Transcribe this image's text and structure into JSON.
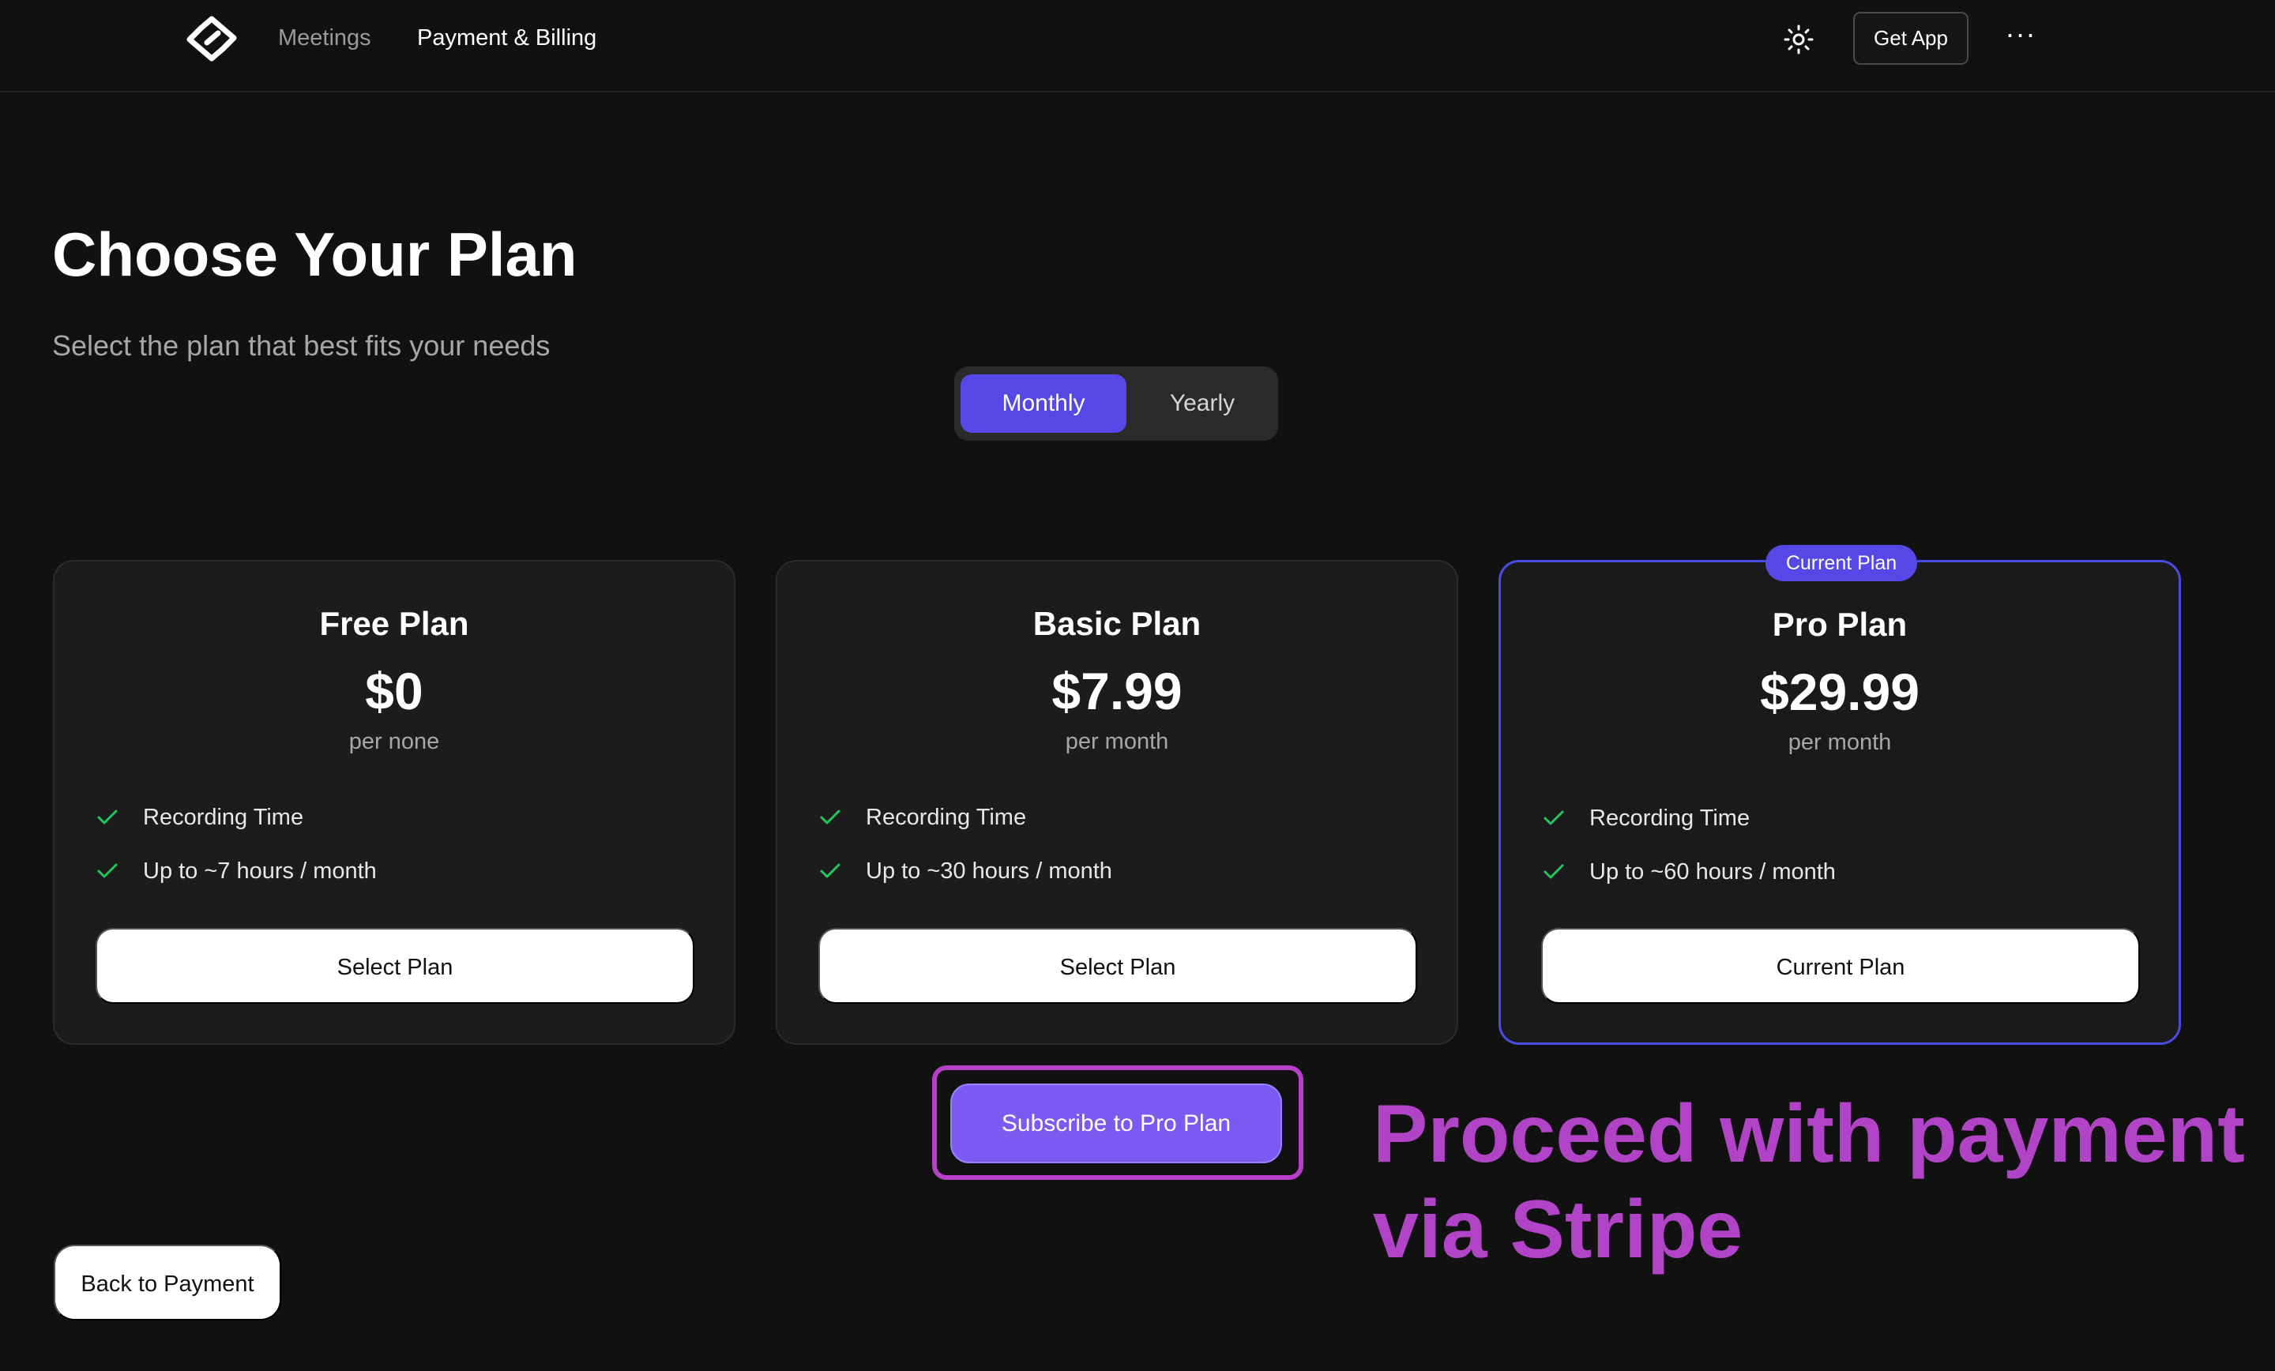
{
  "nav": {
    "logo_icon": "app-logo-icon",
    "links": [
      {
        "label": "Meetings"
      },
      {
        "label": "Payment & Billing"
      }
    ],
    "theme_icon": "sun-icon",
    "get_app_label": "Get App",
    "more_icon": "more-horizontal-icon",
    "more_label": "···"
  },
  "header": {
    "title": "Choose Your Plan",
    "subtitle": "Select the plan that best fits your needs"
  },
  "billing_toggle": {
    "options": [
      "Monthly",
      "Yearly"
    ],
    "selected": "Monthly"
  },
  "plans": [
    {
      "name": "Free Plan",
      "price": "$0",
      "period": "per none",
      "features": [
        "Recording Time",
        "Up to ~7 hours / month"
      ],
      "button_label": "Select Plan",
      "current": false
    },
    {
      "name": "Basic Plan",
      "price": "$7.99",
      "period": "per month",
      "features": [
        "Recording Time",
        "Up to ~30 hours / month"
      ],
      "button_label": "Select Plan",
      "current": false
    },
    {
      "name": "Pro Plan",
      "price": "$29.99",
      "period": "per month",
      "features": [
        "Recording Time",
        "Up to ~60 hours / month"
      ],
      "button_label": "Current Plan",
      "badge": "Current Plan",
      "current": true
    }
  ],
  "subscribe": {
    "label": "Subscribe to Pro Plan"
  },
  "annotation": {
    "text": "Proceed with payment via Stripe"
  },
  "back_button": {
    "label": "Back to Payment"
  },
  "colors": {
    "background": "#111111",
    "card": "#1c1c1c",
    "accent": "#5548e6",
    "subscribe": "#7a5af0",
    "annotation": "#b144c6",
    "check": "#22c55e"
  }
}
